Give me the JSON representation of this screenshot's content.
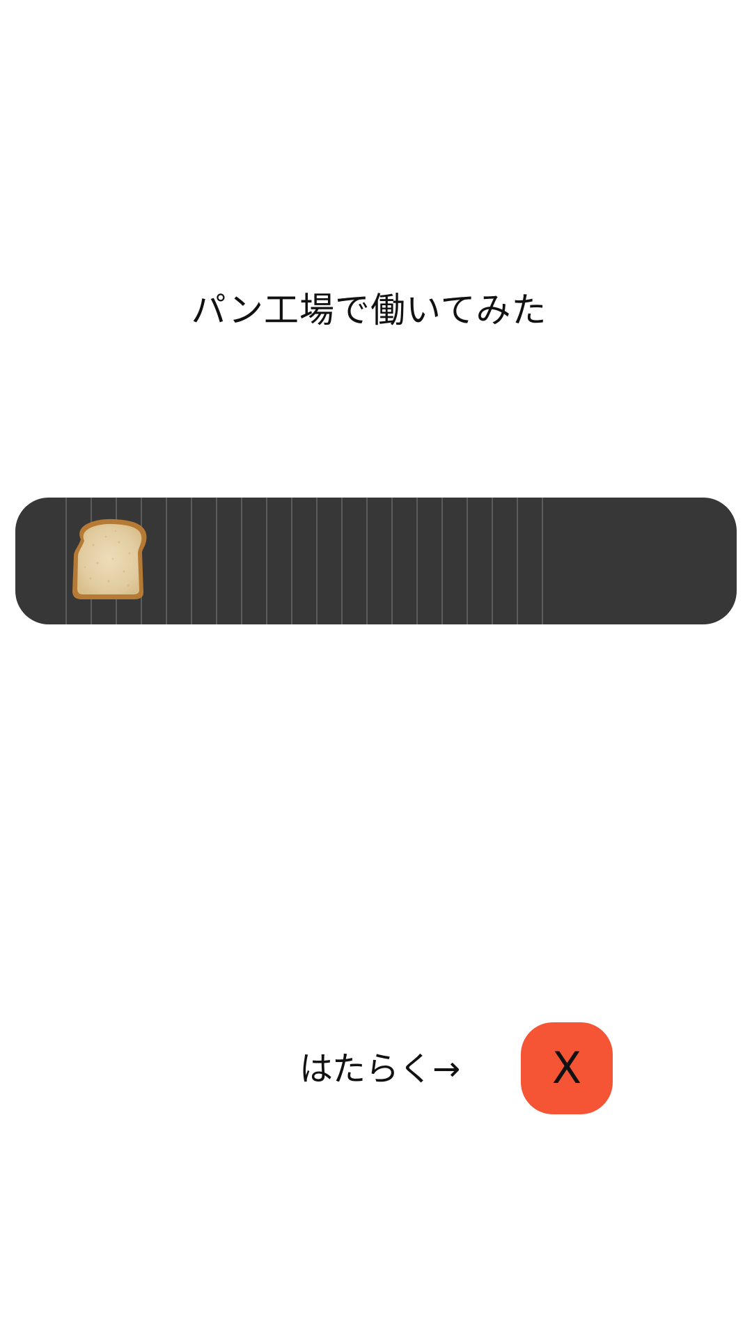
{
  "title": "パン工場で働いてみた",
  "belt": {
    "item": "bread-slice",
    "belt_color": "#373737"
  },
  "controls": {
    "work_label": "はたらく→",
    "close_label": "X",
    "close_color": "#f55535"
  }
}
